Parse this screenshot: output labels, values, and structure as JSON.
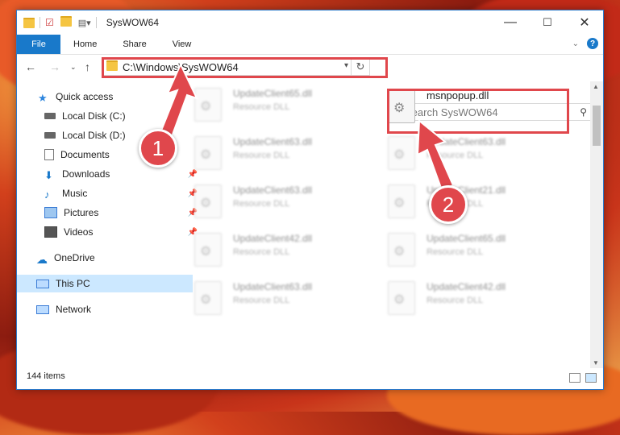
{
  "window": {
    "title": "SysWOW64",
    "controls": [
      "—",
      "☐",
      "✕"
    ]
  },
  "ribbon": {
    "tabs": [
      "File",
      "Home",
      "Share",
      "View"
    ]
  },
  "address": {
    "path": "C:\\Windows\\SysWOW64",
    "search_placeholder": "Search SysWOW64"
  },
  "nav": {
    "items": [
      {
        "label": "Quick access",
        "icon": "star-icon"
      },
      {
        "label": "Local Disk (C:)",
        "icon": "drive-icon"
      },
      {
        "label": "Local Disk (D:)",
        "icon": "drive-icon"
      },
      {
        "label": "Documents",
        "icon": "documents-icon"
      },
      {
        "label": "Downloads",
        "icon": "download-icon"
      },
      {
        "label": "Music",
        "icon": "music-icon"
      },
      {
        "label": "Pictures",
        "icon": "pictures-icon"
      },
      {
        "label": "Videos",
        "icon": "videos-icon"
      },
      {
        "label": "OneDrive",
        "icon": "cloud-icon"
      },
      {
        "label": "This PC",
        "icon": "pc-icon"
      },
      {
        "label": "Network",
        "icon": "network-icon"
      }
    ]
  },
  "files": {
    "highlighted": {
      "name": "msnpopup.dll"
    },
    "left_column": [
      {
        "name": "UpdateClient65.dll",
        "type": "Resource DLL"
      },
      {
        "name": "UpdateClient63.dll",
        "type": "Resource DLL"
      },
      {
        "name": "UpdateClient63.dll",
        "type": "Resource DLL"
      },
      {
        "name": "UpdateClient42.dll",
        "type": "Resource DLL"
      },
      {
        "name": "UpdateClient63.dll",
        "type": "Resource DLL"
      }
    ],
    "right_column": [
      {
        "name": "UpdateClient63.dll",
        "type": "Resource DLL"
      },
      {
        "name": "UpdateClient21.dll",
        "type": "Resource DLL"
      },
      {
        "name": "UpdateClient65.dll",
        "type": "Resource DLL"
      },
      {
        "name": "UpdateClient42.dll",
        "type": "Resource DLL"
      }
    ]
  },
  "status": {
    "item_count": "144 items"
  },
  "annotations": {
    "badge1": "1",
    "badge2": "2",
    "accent_color": "#e0474c"
  }
}
